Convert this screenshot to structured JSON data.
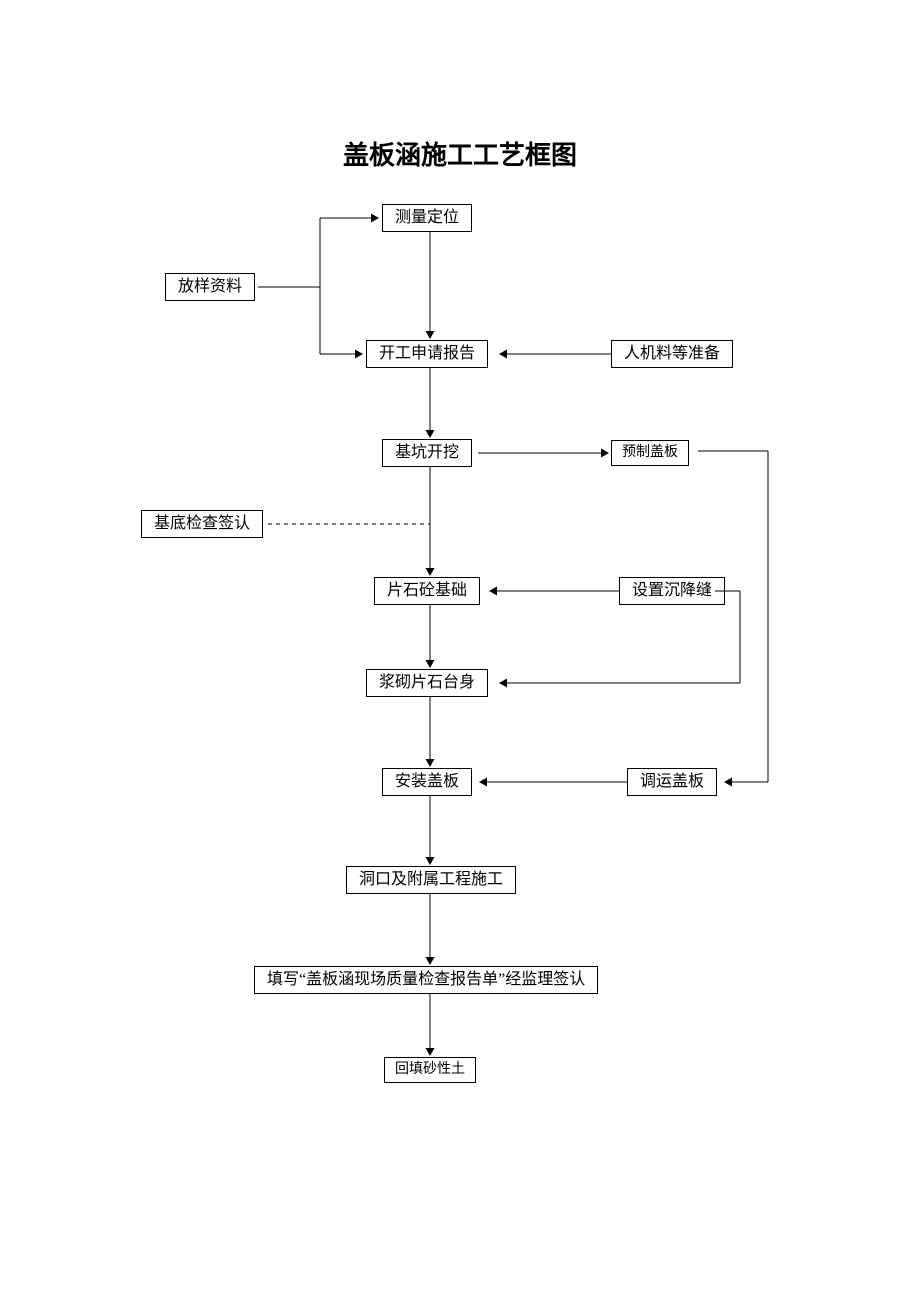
{
  "title": "盖板涵施工工艺框图",
  "nodes": {
    "survey": "测量定位",
    "setout": "放样资料",
    "startReport": "开工申请报告",
    "resources": "人机料等准备",
    "pitExcav": "基坑开挖",
    "prefabSlab": "预制盖板",
    "baseCheck": "基底检查签认",
    "rubbleFound": "片石砼基础",
    "settleJoint": "设置沉降缝",
    "masonryBody": "浆砌片石台身",
    "installSlab": "安装盖板",
    "transSlab": "调运盖板",
    "portalAux": "洞口及附属工程施工",
    "qcForm": "填写“盖板涵现场质量检查报告单”经监理签认",
    "backfill": "回填砂性土"
  }
}
